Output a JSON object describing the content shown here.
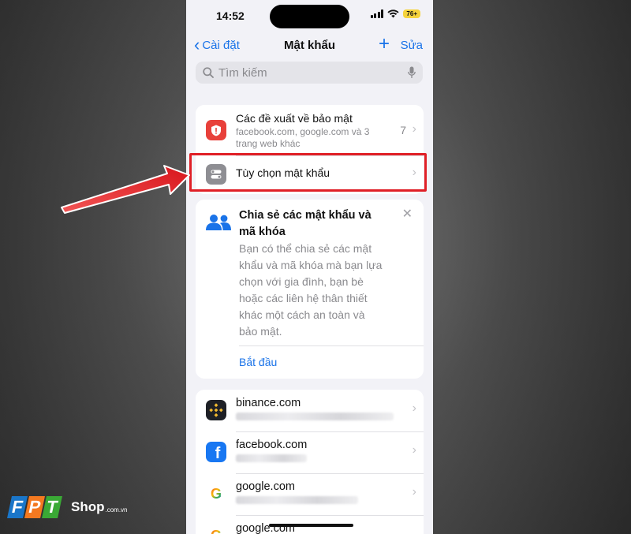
{
  "status_bar": {
    "time": "14:52",
    "battery": "76+"
  },
  "nav": {
    "back_label": "Cài đặt",
    "title": "Mật khẩu",
    "add": "+",
    "edit_label": "Sửa"
  },
  "search": {
    "placeholder": "Tìm kiếm"
  },
  "security": {
    "title": "Các đề xuất về bảo mật",
    "subtitle_line1": "facebook.com, google.com và 3",
    "subtitle_line2": "trang web khác",
    "count": "7"
  },
  "password_options": {
    "label": "Tùy chọn mật khẩu"
  },
  "share_card": {
    "title_line1": "Chia sẻ các mật khẩu và",
    "title_line2": "mã khóa",
    "body_lines": [
      "Bạn có thể chia sẻ các mật",
      "khẩu và mã khóa mà bạn lựa",
      "chọn với gia đình, bạn bè",
      "hoặc các liên hệ thân thiết",
      "khác một cách an toàn và",
      "bảo mật."
    ],
    "start_label": "Bắt đầu"
  },
  "sites": [
    {
      "name": "binance.com",
      "icon": "binance-icon"
    },
    {
      "name": "facebook.com",
      "icon": "facebook-icon"
    },
    {
      "name": "google.com",
      "icon": "google-icon"
    },
    {
      "name": "google.com",
      "icon": "google-icon"
    }
  ],
  "watermark": {
    "brand": "FPT",
    "shop": "Shop",
    "domain": ".com.vn"
  },
  "colors": {
    "accent": "#1a73e8",
    "highlight": "#e01f26",
    "security_icon": "#e8403a"
  }
}
